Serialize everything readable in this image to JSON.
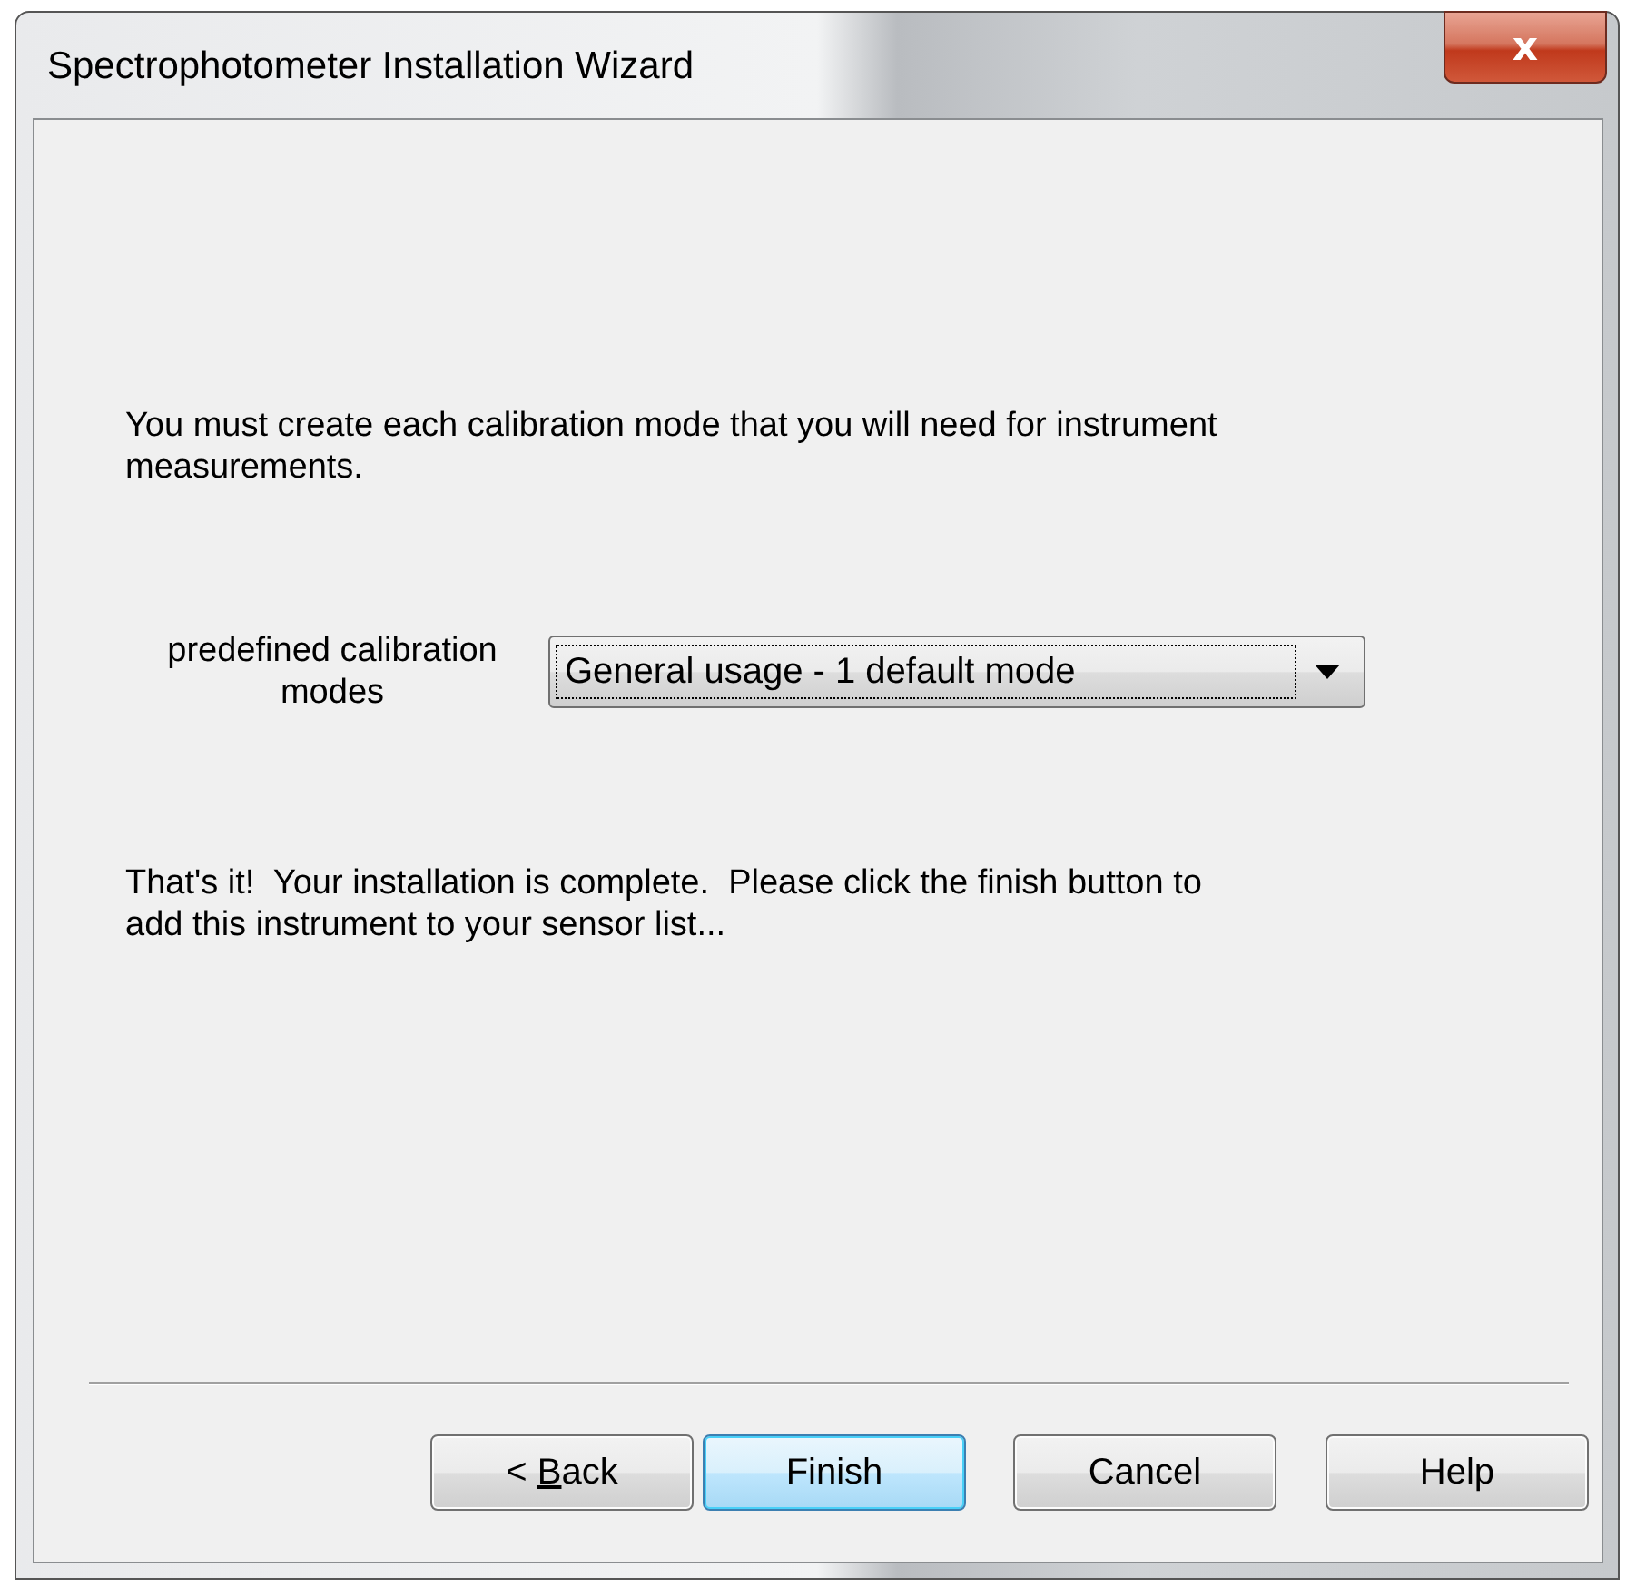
{
  "window": {
    "title": "Spectrophotometer Installation Wizard",
    "close": "x"
  },
  "intro": "You must create each calibration mode that you will need for instrument measurements.",
  "calibration": {
    "label": "predefined calibration modes",
    "value": "General usage - 1 default mode",
    "focused": true
  },
  "completion": "That's it!  Your installation is complete.  Please click the finish button to add this instrument to your sensor list...",
  "buttons": [
    {
      "label": "< Back",
      "access_key": true,
      "default": false
    },
    {
      "label": "Finish",
      "default": true
    },
    {
      "label": "Cancel",
      "default": false
    },
    {
      "label": "Help",
      "default": false
    }
  ]
}
